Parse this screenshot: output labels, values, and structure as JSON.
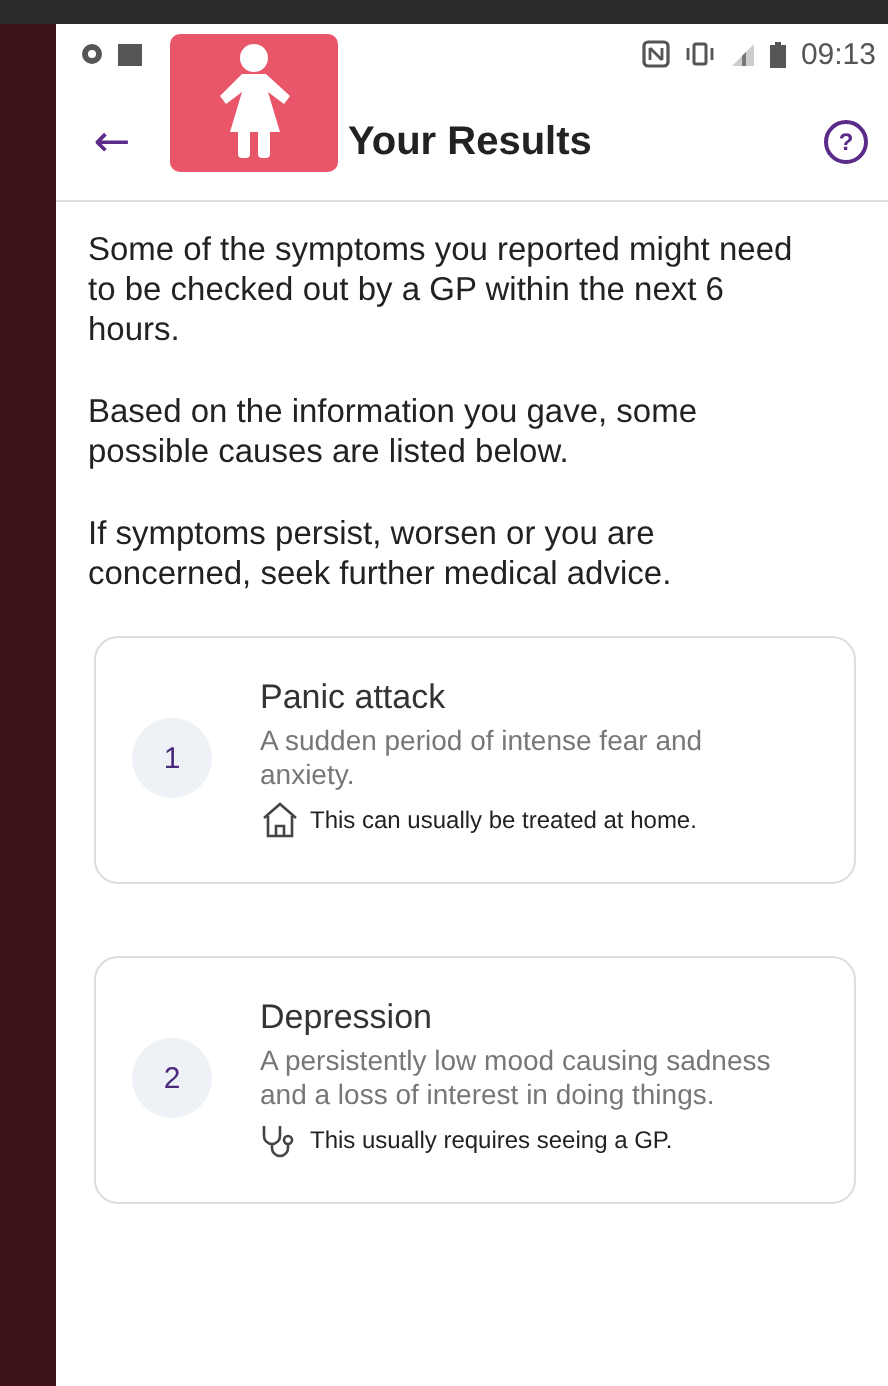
{
  "status_bar": {
    "time": "09:13"
  },
  "header": {
    "title": "Your Results",
    "back_label": "←",
    "help_label": "?"
  },
  "intro": [
    "Some of the symptoms you reported might need to be checked out by a GP within the next 6 hours.",
    "Based on the information you gave, some possible causes are listed below.",
    "If symptoms persist, worsen or you are concerned, seek further medical advice."
  ],
  "results": [
    {
      "number": "1",
      "title": "Panic attack",
      "description": "A sudden period of intense fear and anxiety.",
      "advice": {
        "kind": "home",
        "text": "This can usually be treated at home."
      }
    },
    {
      "number": "2",
      "title": "Depression",
      "description": "A persistently low mood causing sadness and a loss of interest in doing things.",
      "advice": {
        "kind": "gp",
        "text": "This usually requires seeing a GP."
      }
    }
  ]
}
